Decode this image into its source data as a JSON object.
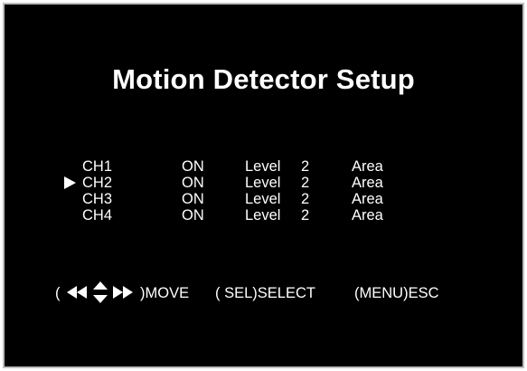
{
  "title": "Motion Detector Setup",
  "selected_row": 1,
  "channels": [
    {
      "name": "CH1",
      "state": "ON",
      "level_label": "Level",
      "level": "2",
      "area_label": "Area"
    },
    {
      "name": "CH2",
      "state": "ON",
      "level_label": "Level",
      "level": "2",
      "area_label": "Area"
    },
    {
      "name": "CH3",
      "state": "ON",
      "level_label": "Level",
      "level": "2",
      "area_label": "Area"
    },
    {
      "name": "CH4",
      "state": "ON",
      "level_label": "Level",
      "level": "2",
      "area_label": "Area"
    }
  ],
  "help": {
    "open_paren": "(",
    "move": ")MOVE",
    "select": "( SEL)SELECT",
    "esc": "(MENU)ESC"
  },
  "icons": {
    "cursor": "selection-triangle-icon",
    "nav": "navigation-arrows-icon"
  },
  "colors": {
    "background": "#000000",
    "text": "#ffffff",
    "frame": "#bdbdbd"
  }
}
